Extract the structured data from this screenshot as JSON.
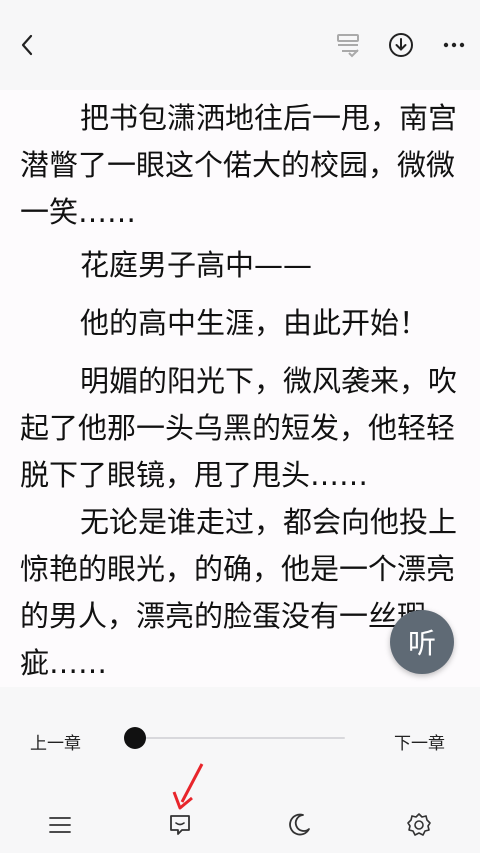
{
  "header": {
    "back_icon": "back-arrow-icon",
    "bookshelf_icon": "bookshelf-icon",
    "download_icon": "download-icon",
    "more_icon": "more-dots-icon"
  },
  "content": {
    "paragraphs": [
      "把书包潇洒地往后一甩，南宫潜瞥了一眼这个偌大的校园，微微一笑……",
      "花庭男子高中——",
      "他的高中生涯，由此开始！",
      "明媚的阳光下，微风袭来，吹起了他那一头乌黑的短发，他轻轻脱下了眼镜，甩了甩头……",
      "无论是谁走过，都会向他投上惊艳的眼光，的确，他是一个漂亮的男人，漂亮的脸蛋没有一丝瑕疵……"
    ]
  },
  "listen_button": {
    "label": "听"
  },
  "bottom_bar": {
    "prev_chapter": "上一章",
    "next_chapter": "下一章",
    "progress": 0.0,
    "tools": [
      "menu-icon",
      "comment-icon",
      "night-mode-icon",
      "settings-icon"
    ]
  },
  "colors": {
    "accent_red": "#e8252b",
    "fab": "#5f6a75"
  }
}
